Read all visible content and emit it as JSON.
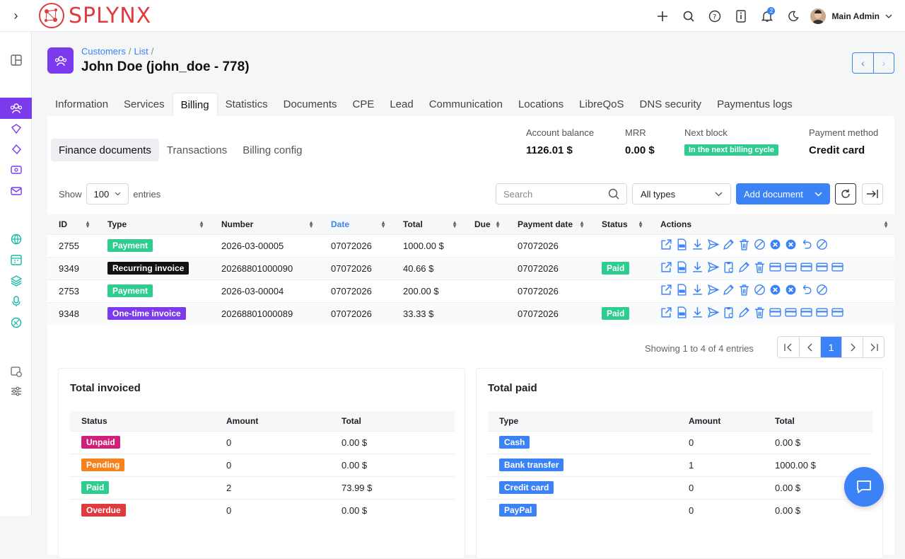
{
  "app": {
    "brand": "SPLYNX",
    "user": "Main Admin",
    "notification_count": "2"
  },
  "breadcrumb": [
    "Customers",
    "List"
  ],
  "page_title": "John Doe (john_doe - 778)",
  "tabs": [
    "Information",
    "Services",
    "Billing",
    "Statistics",
    "Documents",
    "CPE",
    "Lead",
    "Communication",
    "Locations",
    "LibreQoS",
    "DNS security",
    "Paymentus logs"
  ],
  "active_tab": "Billing",
  "subtabs": [
    "Finance documents",
    "Transactions",
    "Billing config"
  ],
  "summary": {
    "balance_label": "Account balance",
    "balance": "1126.01 $",
    "mrr_label": "MRR",
    "mrr": "0.00 $",
    "block_label": "Next block",
    "block": "In the next billing cycle",
    "method_label": "Payment method",
    "method": "Credit card"
  },
  "controls": {
    "show": "Show",
    "entries_count": "100",
    "entries": "entries",
    "search_placeholder": "Search",
    "type_filter": "All types",
    "add_document": "Add document"
  },
  "table": {
    "headers": [
      "ID",
      "Type",
      "Number",
      "Date",
      "Total",
      "Due",
      "Payment date",
      "Status",
      "Actions"
    ],
    "rows": [
      {
        "id": "2755",
        "type": "Payment",
        "number": "2026-03-00005",
        "date": "07072026",
        "total": "1000.00 $",
        "due": "",
        "pay_date": "07072026",
        "status": ""
      },
      {
        "id": "9349",
        "type": "Recurring invoice",
        "number": "20268801000090",
        "date": "07072026",
        "total": "40.66 $",
        "due": "",
        "pay_date": "07072026",
        "status": "Paid"
      },
      {
        "id": "2753",
        "type": "Payment",
        "number": "2026-03-00004",
        "date": "07072026",
        "total": "200.00 $",
        "due": "",
        "pay_date": "07072026",
        "status": ""
      },
      {
        "id": "9348",
        "type": "One-time invoice",
        "number": "20268801000089",
        "date": "07072026",
        "total": "33.33 $",
        "due": "",
        "pay_date": "07072026",
        "status": "Paid"
      }
    ]
  },
  "pagination": {
    "info": "Showing 1 to 4 of 4 entries",
    "page": "1"
  },
  "total_invoiced": {
    "title": "Total invoiced",
    "headers": [
      "Status",
      "Amount",
      "Total"
    ],
    "rows": [
      {
        "status": "Unpaid",
        "amount": "0",
        "total": "0.00 $"
      },
      {
        "status": "Pending",
        "amount": "0",
        "total": "0.00 $"
      },
      {
        "status": "Paid",
        "amount": "2",
        "total": "73.99 $"
      },
      {
        "status": "Overdue",
        "amount": "0",
        "total": "0.00 $"
      }
    ]
  },
  "total_paid": {
    "title": "Total paid",
    "headers": [
      "Type",
      "Amount",
      "Total"
    ],
    "rows": [
      {
        "type": "Cash",
        "amount": "0",
        "total": "0.00 $"
      },
      {
        "type": "Bank transfer",
        "amount": "1",
        "total": "1000.00 $"
      },
      {
        "type": "Credit card",
        "amount": "0",
        "total": "0.00 $"
      },
      {
        "type": "PayPal",
        "amount": "0",
        "total": "0.00 $"
      }
    ]
  },
  "colors": {
    "accent": "#3b82f6",
    "purple": "#7c3aed",
    "brand_red": "#e03a3e",
    "green": "#2ecc8f"
  }
}
